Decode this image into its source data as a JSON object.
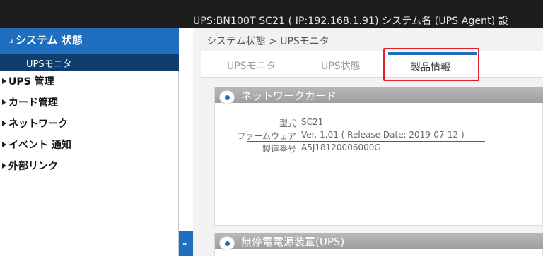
{
  "topbar": {
    "text": "UPS:BN100T   SC21 ( IP:192.168.1.91)   システム名 (UPS Agent)   設"
  },
  "sidebar": {
    "header": "システム 状態",
    "sub_item": "UPSモニタ",
    "items": [
      {
        "label": "UPS 管理"
      },
      {
        "label": "カード管理"
      },
      {
        "label": "ネットワーク"
      },
      {
        "label": "イベント 通知"
      },
      {
        "label": "外部リンク"
      }
    ]
  },
  "breadcrumb": "システム状態 > UPSモニタ",
  "tabs": [
    {
      "label": "UPSモニタ",
      "active": false
    },
    {
      "label": "UPS状態",
      "active": false
    },
    {
      "label": "製品情報",
      "active": true
    }
  ],
  "panel_network": {
    "title": "ネットワークカード",
    "rows": [
      {
        "label": "型式",
        "value": "SC21"
      },
      {
        "label": "ファームウェア",
        "value": "Ver. 1.01 ( Release Date: 2019-07-12 )"
      },
      {
        "label": "製造番号",
        "value": "A5J18120006000G"
      }
    ]
  },
  "panel_ups": {
    "title": "無停電電源装置(UPS)"
  },
  "collapse_glyph": "«",
  "colors": {
    "accent": "#1e6fbf",
    "highlight": "#e5202a"
  }
}
